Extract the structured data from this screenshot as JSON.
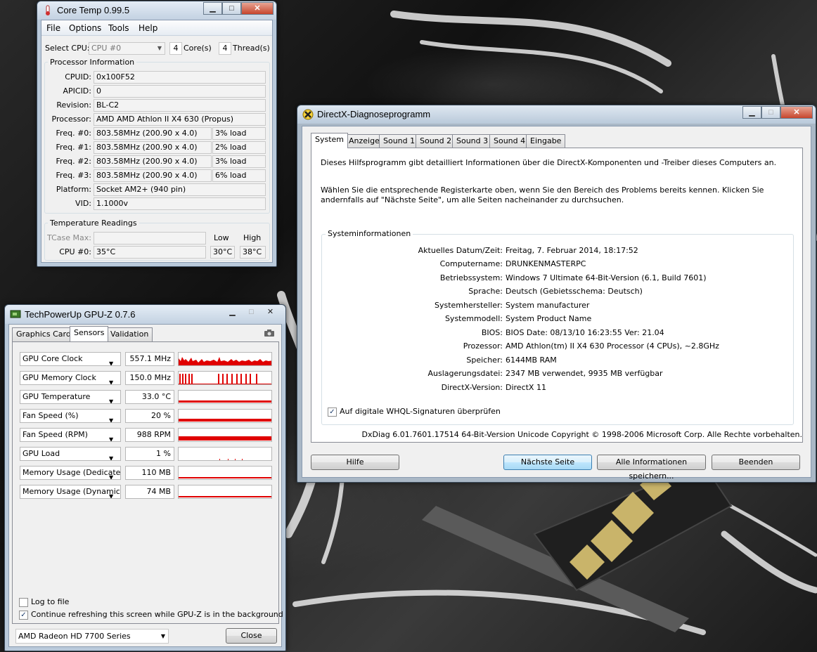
{
  "coretemp": {
    "title": "Core Temp 0.99.5",
    "menu": [
      "File",
      "Options",
      "Tools",
      "Help"
    ],
    "select_cpu_label": "Select CPU:",
    "cpu_select": "CPU #0",
    "cores_count": "4",
    "cores_label": "Core(s)",
    "threads_count": "4",
    "threads_label": "Thread(s)",
    "proc_info_title": "Processor Information",
    "rows": [
      {
        "label": "CPUID:",
        "value": "0x100F52"
      },
      {
        "label": "APICID:",
        "value": "0"
      },
      {
        "label": "Revision:",
        "value": "BL-C2"
      },
      {
        "label": "Processor:",
        "value": "AMD AMD Athlon II X4 630 (Propus)"
      }
    ],
    "freqs": [
      {
        "label": "Freq. #0:",
        "value": "803.58MHz (200.90 x 4.0)",
        "load": "3% load"
      },
      {
        "label": "Freq. #1:",
        "value": "803.58MHz (200.90 x 4.0)",
        "load": "2% load"
      },
      {
        "label": "Freq. #2:",
        "value": "803.58MHz (200.90 x 4.0)",
        "load": "3% load"
      },
      {
        "label": "Freq. #3:",
        "value": "803.58MHz (200.90 x 4.0)",
        "load": "6% load"
      }
    ],
    "platform_label": "Platform:",
    "platform_value": "Socket AM2+ (940 pin)",
    "vid_label": "VID:",
    "vid_value": "1.1000v",
    "temp_title": "Temperature Readings",
    "tcase_label": "TCase Max:",
    "low_label": "Low",
    "high_label": "High",
    "cpu0_label": "CPU #0:",
    "cpu0_temp": "35°C",
    "cpu0_low": "30°C",
    "cpu0_high": "38°C"
  },
  "gpuz": {
    "title": "TechPowerUp GPU-Z 0.7.6",
    "tabs": [
      "Graphics Card",
      "Sensors",
      "Validation"
    ],
    "sensors": [
      {
        "name": "GPU Core Clock",
        "value": "557.1 MHz"
      },
      {
        "name": "GPU Memory Clock",
        "value": "150.0 MHz"
      },
      {
        "name": "GPU Temperature",
        "value": "33.0 °C"
      },
      {
        "name": "Fan Speed (%)",
        "value": "20 %"
      },
      {
        "name": "Fan Speed (RPM)",
        "value": "988 RPM"
      },
      {
        "name": "GPU Load",
        "value": "1 %"
      },
      {
        "name": "Memory Usage (Dedicated)",
        "value": "110 MB"
      },
      {
        "name": "Memory Usage (Dynamic)",
        "value": "74 MB"
      }
    ],
    "log_label": "Log to file",
    "refresh_label": "Continue refreshing this screen while GPU-Z is in the background",
    "gpu_select": "AMD Radeon HD 7700 Series",
    "close_label": "Close"
  },
  "dxdiag": {
    "title": "DirectX-Diagnoseprogramm",
    "tabs": [
      "System",
      "Anzeige",
      "Sound 1",
      "Sound 2",
      "Sound 3",
      "Sound 4",
      "Eingabe"
    ],
    "intro1": "Dieses Hilfsprogramm gibt detailliert Informationen über die DirectX-Komponenten und -Treiber dieses Computers an.",
    "intro2": "Wählen Sie die entsprechende Registerkarte oben, wenn Sie den Bereich des Problems bereits kennen. Klicken Sie andernfalls auf \"Nächste Seite\", um alle Seiten nacheinander zu durchsuchen.",
    "group_title": "Systeminformationen",
    "info": [
      {
        "label": "Aktuelles Datum/Zeit:",
        "value": "Freitag, 7. Februar 2014, 18:17:52"
      },
      {
        "label": "Computername:",
        "value": "DRUNKENMASTERPC"
      },
      {
        "label": "Betriebssystem:",
        "value": "Windows 7 Ultimate 64-Bit-Version (6.1, Build 7601)"
      },
      {
        "label": "Sprache:",
        "value": "Deutsch (Gebietsschema: Deutsch)"
      },
      {
        "label": "Systemhersteller:",
        "value": "System manufacturer"
      },
      {
        "label": "Systemmodell:",
        "value": "System Product Name"
      },
      {
        "label": "BIOS:",
        "value": "BIOS Date: 08/13/10 16:23:55 Ver: 21.04"
      },
      {
        "label": "Prozessor:",
        "value": "AMD Athlon(tm) II X4 630 Processor (4 CPUs), ~2.8GHz"
      },
      {
        "label": "Speicher:",
        "value": "6144MB RAM"
      },
      {
        "label": "Auslagerungsdatei:",
        "value": "2347 MB verwendet, 9935 MB verfügbar"
      },
      {
        "label": "DirectX-Version:",
        "value": "DirectX 11"
      }
    ],
    "whql_label": "Auf digitale WHQL-Signaturen überprüfen",
    "copyright": "DxDiag 6.01.7601.17514 64-Bit-Version Unicode Copyright © 1998-2006 Microsoft Corp. Alle Rechte vorbehalten.",
    "btn_help": "Hilfe",
    "btn_next": "Nächste Seite",
    "btn_saveall": "Alle Informationen speichern...",
    "btn_exit": "Beenden"
  }
}
